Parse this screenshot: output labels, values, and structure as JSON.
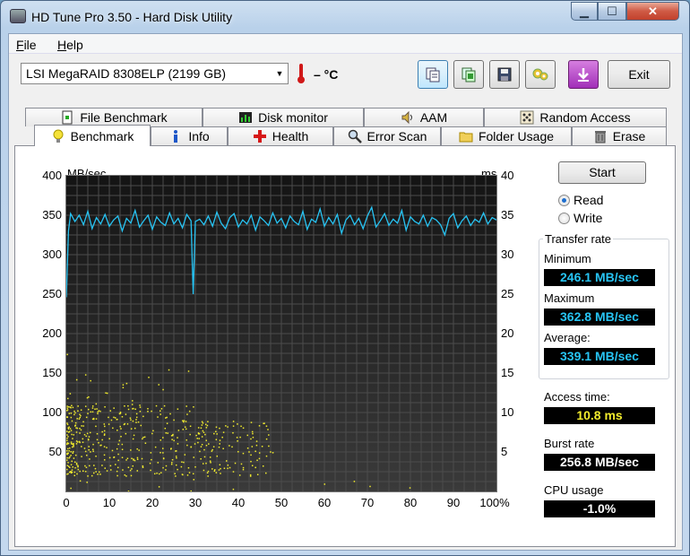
{
  "window": {
    "title": "HD Tune Pro 3.50 - Hard Disk Utility",
    "min_glyph": "▁",
    "max_glyph": "☐",
    "close_glyph": "✕"
  },
  "menu": [
    {
      "hot": "F",
      "rest": "ile"
    },
    {
      "hot": "H",
      "rest": "elp"
    }
  ],
  "toolbar": {
    "drive": "LSI    MegaRAID 8308ELP (2199 GB)",
    "temperature": "– °C",
    "exit_label": "Exit",
    "icons": [
      "copy-info-icon",
      "copy-screenshot-icon",
      "save-icon",
      "options-icon",
      "download-icon"
    ]
  },
  "tabs_top": [
    "File Benchmark",
    "Disk monitor",
    "AAM",
    "Random Access"
  ],
  "tabs_bottom": [
    "Benchmark",
    "Info",
    "Health",
    "Error Scan",
    "Folder Usage",
    "Erase"
  ],
  "selected_tab": "Benchmark",
  "controls": {
    "start_label": "Start",
    "read_label": "Read",
    "write_label": "Write",
    "mode": "Read"
  },
  "transfer_rate": {
    "title": "Transfer rate",
    "minimum_label": "Minimum",
    "minimum": "246.1 MB/sec",
    "maximum_label": "Maximum",
    "maximum": "362.8 MB/sec",
    "average_label": "Average:",
    "average": "339.1 MB/sec"
  },
  "access_time": {
    "label": "Access time:",
    "value": "10.8 ms"
  },
  "burst_rate": {
    "label": "Burst rate",
    "value": "256.8 MB/sec"
  },
  "cpu_usage": {
    "label": "CPU usage",
    "value": "-1.0%"
  },
  "colors": {
    "transfer_line": "#27c4f4",
    "access_dots": "#f2ec2d",
    "chart_bg": "#1e1e1e"
  },
  "chart_data": {
    "type": "line",
    "ylabel_left": "MB/sec",
    "ylabel_right": "ms",
    "ylim_left": [
      0,
      400
    ],
    "ylim_right": [
      0,
      40
    ],
    "yticks_left": [
      "400",
      "350",
      "300",
      "250",
      "200",
      "150",
      "100",
      "50"
    ],
    "yticks_right": [
      "40",
      "35",
      "30",
      "25",
      "20",
      "15",
      "10",
      "5"
    ],
    "xticks": [
      "0",
      "10",
      "20",
      "30",
      "40",
      "50",
      "60",
      "70",
      "80",
      "90",
      "100%"
    ],
    "xlim": [
      0,
      100
    ],
    "grid": true,
    "series": [
      {
        "kind": "line",
        "axis": "left",
        "x": [
          0,
          0.5,
          1,
          2,
          3,
          4,
          5,
          6,
          7,
          8,
          9,
          10,
          11,
          12,
          13,
          14,
          15,
          16,
          17,
          18,
          19,
          20,
          21,
          22,
          23,
          24,
          25,
          26,
          27,
          28,
          29,
          29.5,
          30,
          31,
          32,
          33,
          34,
          35,
          36,
          37,
          38,
          39,
          40,
          41,
          42,
          43,
          44,
          45,
          46,
          47,
          48,
          49,
          50,
          51,
          52,
          53,
          54,
          55,
          56,
          57,
          58,
          59,
          60,
          61,
          62,
          63,
          64,
          65,
          66,
          67,
          68,
          69,
          70,
          71,
          72,
          73,
          74,
          75,
          76,
          77,
          78,
          79,
          80,
          81,
          82,
          83,
          84,
          85,
          86,
          87,
          88,
          89,
          90,
          91,
          92,
          93,
          94,
          95,
          96,
          97,
          98,
          99,
          100
        ],
        "y": [
          246,
          330,
          352,
          342,
          350,
          338,
          355,
          333,
          347,
          339,
          351,
          336,
          344,
          349,
          330,
          346,
          340,
          356,
          335,
          343,
          350,
          332,
          348,
          341,
          337,
          353,
          339,
          346,
          334,
          351,
          343,
          250,
          342,
          345,
          338,
          349,
          336,
          354,
          340,
          333,
          347,
          352,
          335,
          344,
          339,
          350,
          331,
          348,
          343,
          337,
          353,
          340,
          346,
          334,
          349,
          342,
          338,
          355,
          332,
          345,
          341,
          358,
          336,
          347,
          339,
          351,
          327,
          344,
          350,
          338,
          346,
          333,
          349,
          360,
          335,
          343,
          352,
          337,
          345,
          340,
          356,
          331,
          348,
          342,
          339,
          350,
          336,
          347,
          344,
          338,
          325,
          346,
          352,
          334,
          343,
          349,
          337,
          345,
          341,
          353,
          339,
          347,
          344
        ]
      },
      {
        "kind": "scatter",
        "axis": "right",
        "note": "access time samples 0–12 ms, concentrated 0–45%"
      }
    ]
  }
}
